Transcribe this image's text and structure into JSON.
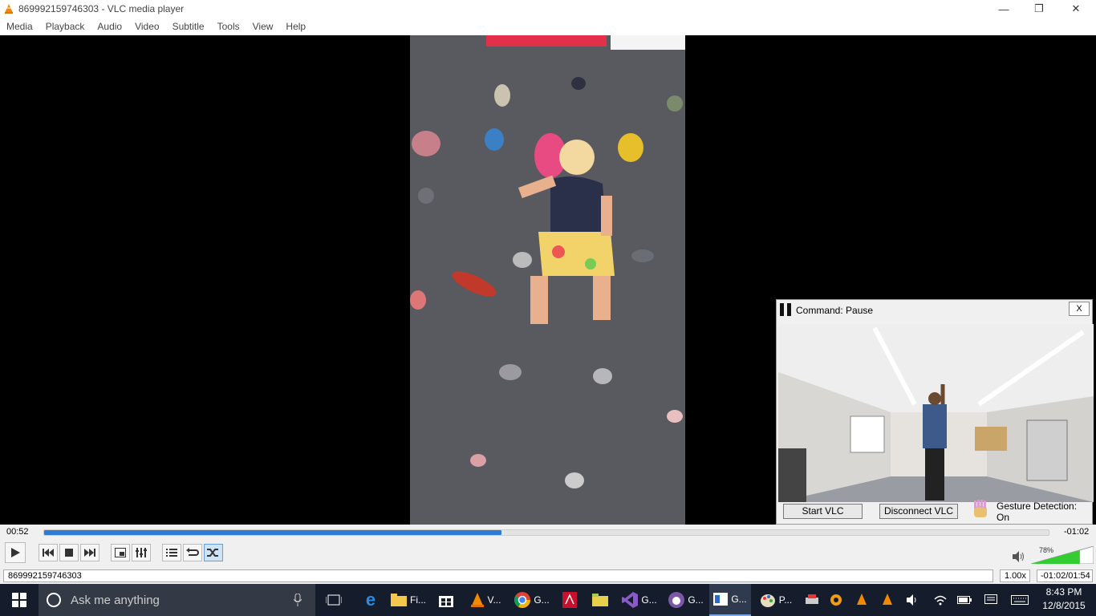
{
  "window": {
    "title": "869992159746303 - VLC media player",
    "controls": {
      "minimize": "—",
      "restore": "❐",
      "close": "✕"
    }
  },
  "menu": [
    "Media",
    "Playback",
    "Audio",
    "Video",
    "Subtitle",
    "Tools",
    "View",
    "Help"
  ],
  "gesture_window": {
    "command": "Command: Pause",
    "close_label": "X",
    "start_button": "Start VLC",
    "disconnect_button": "Disconnect VLC",
    "status": "Gesture Detection: On"
  },
  "player": {
    "elapsed": "00:52",
    "remaining": "-01:02",
    "progress_fraction": 0.455,
    "volume_label": "78%",
    "volume_fraction": 0.78,
    "filename": "869992159746303",
    "speed": "1.00x",
    "time_status": "-01:02/01:54"
  },
  "taskbar": {
    "search_placeholder": "Ask me anything",
    "apps": [
      "Fi...",
      "V...",
      "G...",
      "G...",
      "G...",
      "G...",
      "P..."
    ],
    "time": "8:43 PM",
    "date": "12/8/2015"
  },
  "colors": {
    "accent": "#2f7bd4",
    "taskbar": "#151c2b",
    "volume": "#33cc33"
  }
}
